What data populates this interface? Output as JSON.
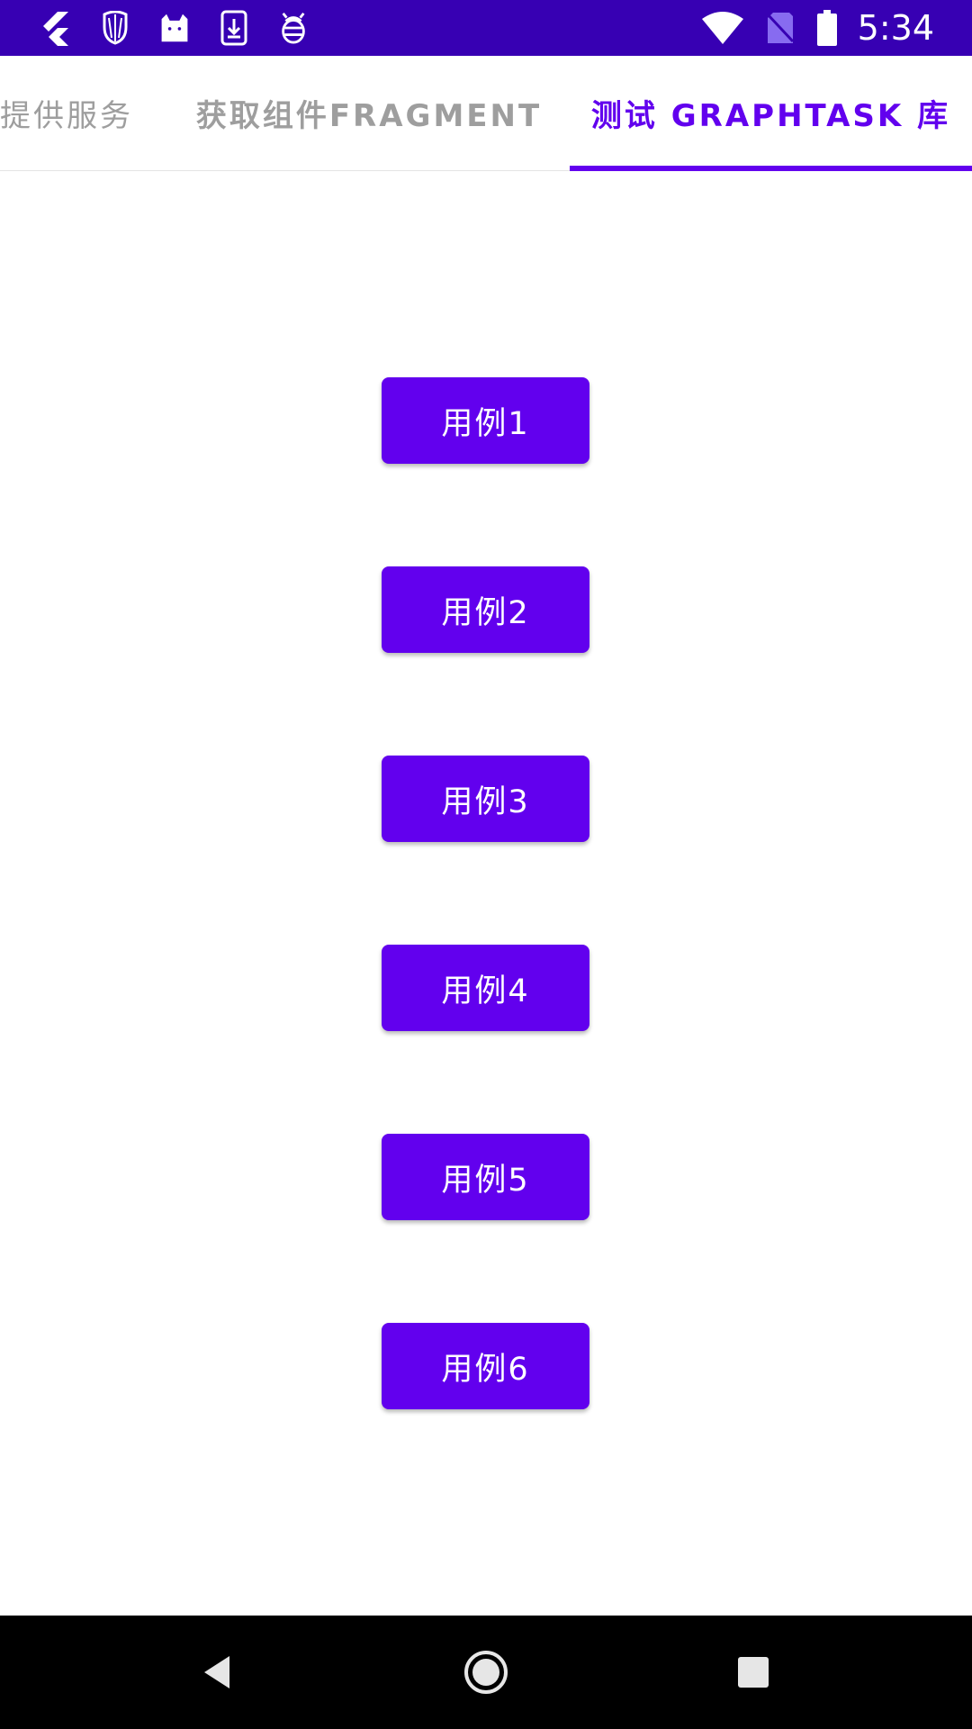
{
  "status_bar": {
    "time": "5:34",
    "bg_color": "#3700b3",
    "left_icons": [
      "flutter-icon",
      "mask-icon",
      "cat-icon",
      "download-icon",
      "bug-icon"
    ],
    "right_icons": [
      "wifi-icon",
      "no-sim-icon",
      "battery-icon"
    ]
  },
  "tabs": [
    {
      "label": "提供服务",
      "selected": false
    },
    {
      "label": "获取组件FRAGMENT",
      "selected": false
    },
    {
      "label": "测试 GRAPHTASK 库",
      "selected": true
    }
  ],
  "accent_color": "#6200ee",
  "buttons": [
    {
      "label": "用例1"
    },
    {
      "label": "用例2"
    },
    {
      "label": "用例3"
    },
    {
      "label": "用例4"
    },
    {
      "label": "用例5"
    },
    {
      "label": "用例6"
    }
  ],
  "nav_bar": {
    "icons": [
      "back-icon",
      "home-icon",
      "recents-icon"
    ]
  }
}
